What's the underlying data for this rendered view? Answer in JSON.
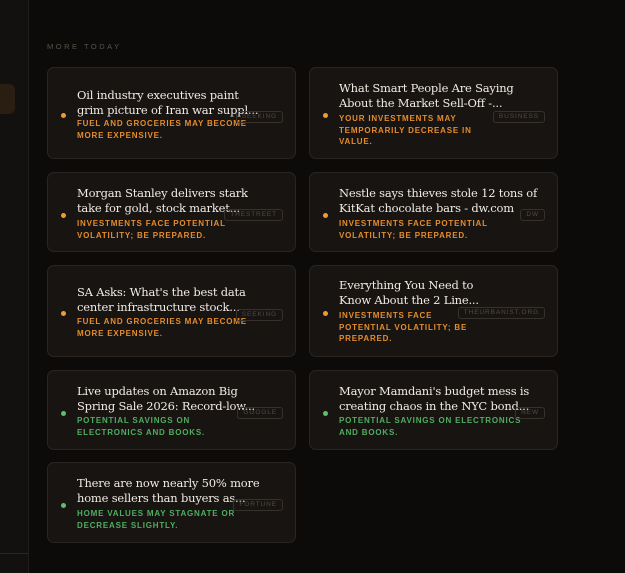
{
  "section_label": "MORE TODAY",
  "cards": [
    {
      "title_l1": "Oil industry executives paint",
      "title_l2": "grim picture of Iran war suppl...",
      "impact_l1": "FUEL AND GROCERIES MAY BECOME",
      "impact_l2": "MORE EXPENSIVE.",
      "impact_l3": "",
      "tag": "SEEKING",
      "tone": "orange"
    },
    {
      "title_l1": "What Smart People Are Saying",
      "title_l2": "About the Market Sell-Off -...",
      "impact_l1": "YOUR INVESTMENTS MAY",
      "impact_l2": "TEMPORARILY DECREASE IN",
      "impact_l3": "VALUE.",
      "tag": "BUSINESS",
      "tone": "orange"
    },
    {
      "title_l1": "Morgan Stanley delivers stark",
      "title_l2": "take for gold, stock market...",
      "impact_l1": "INVESTMENTS FACE POTENTIAL",
      "impact_l2": "VOLATILITY; BE PREPARED.",
      "impact_l3": "",
      "tag": "THESTREET",
      "tone": "orange"
    },
    {
      "title_l1": "Nestle says thieves stole 12 tons of",
      "title_l2": "KitKat chocolate bars - dw.com",
      "impact_l1": "INVESTMENTS FACE POTENTIAL",
      "impact_l2": "VOLATILITY; BE PREPARED.",
      "impact_l3": "",
      "tag": "DW",
      "tone": "orange"
    },
    {
      "title_l1": "SA Asks: What's the best data",
      "title_l2": "center infrastructure stock...",
      "impact_l1": "FUEL AND GROCERIES MAY BECOME",
      "impact_l2": "MORE EXPENSIVE.",
      "impact_l3": "",
      "tag": "SEEKING",
      "tone": "orange"
    },
    {
      "title_l1": "Everything You Need to",
      "title_l2": "Know About the 2 Line...",
      "impact_l1": "INVESTMENTS FACE",
      "impact_l2": "POTENTIAL VOLATILITY; BE",
      "impact_l3": "PREPARED.",
      "tag": "THEURBANIST.ORG",
      "tone": "orange"
    },
    {
      "title_l1": "Live updates on Amazon Big",
      "title_l2": "Spring Sale 2026: Record-low...",
      "impact_l1": "POTENTIAL SAVINGS ON",
      "impact_l2": "ELECTRONICS AND BOOKS.",
      "impact_l3": "",
      "tag": "GOOGLE",
      "tone": "green"
    },
    {
      "title_l1": "Mayor Mamdani's budget mess is",
      "title_l2": "creating chaos in the NYC bond...",
      "impact_l1": "POTENTIAL SAVINGS ON ELECTRONICS",
      "impact_l2": "AND BOOKS.",
      "impact_l3": "",
      "tag": "NEW",
      "tone": "green"
    },
    {
      "title_l1": "There are now nearly 50% more",
      "title_l2": "home sellers than buyers as...",
      "impact_l1": "HOME VALUES MAY STAGNATE OR",
      "impact_l2": "DECREASE SLIGHTLY.",
      "impact_l3": "",
      "tag": "FORTUNE",
      "tone": "green"
    }
  ]
}
